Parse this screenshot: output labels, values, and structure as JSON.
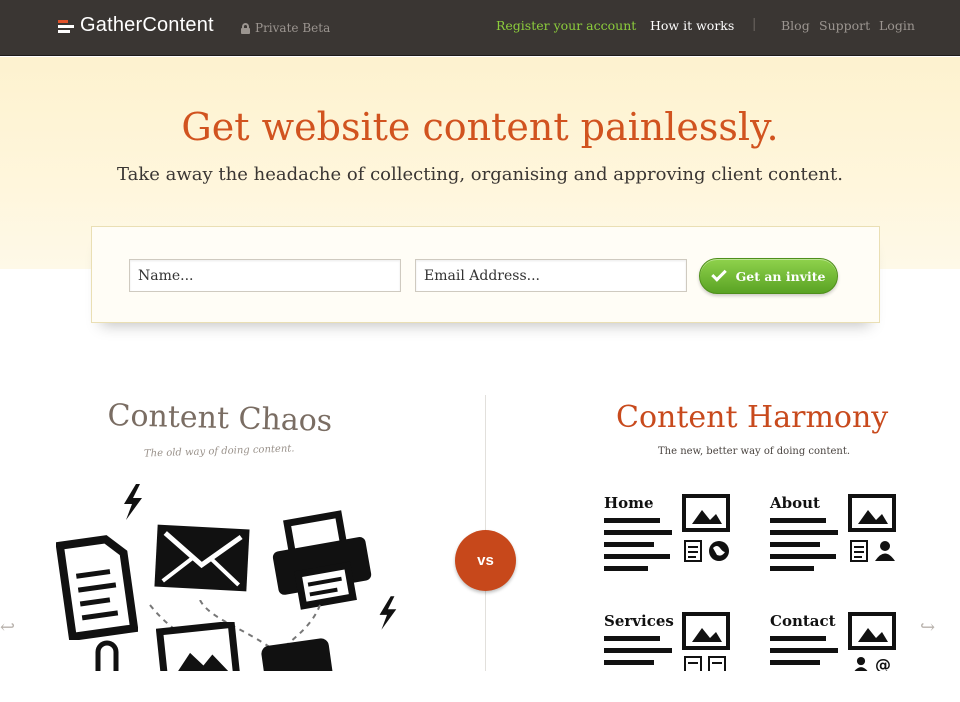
{
  "nav": {
    "brand": "GatherContent",
    "beta": "Private Beta",
    "register": "Register your account",
    "how_it_works": "How it works",
    "separator": "|",
    "blog": "Blog",
    "support": "Support",
    "login": "Login"
  },
  "hero": {
    "title": "Get website content painlessly.",
    "subtitle": "Take away the headache of collecting, organising and approving client content."
  },
  "invite": {
    "name_placeholder": "Name...",
    "email_placeholder": "Email Address...",
    "button_label": "Get an invite",
    "button_color": "#6ab72f"
  },
  "compare": {
    "chaos_title": "Content Chaos",
    "chaos_subtitle": "The old way of doing content.",
    "vs_label": "vs",
    "harmony_title": "Content Harmony",
    "harmony_subtitle": "The new, better way of doing content.",
    "cards": [
      {
        "label": "Home",
        "icons": [
          "document-icon",
          "globe-icon"
        ]
      },
      {
        "label": "About",
        "icons": [
          "document-icon",
          "person-icon"
        ]
      },
      {
        "label": "Services",
        "icons": [
          "document-icon",
          "document-icon"
        ]
      },
      {
        "label": "Contact",
        "icons": [
          "person-icon",
          "at-icon"
        ]
      }
    ]
  },
  "colors": {
    "accent": "#d1531f",
    "topbar": "#3a3633",
    "nav_highlight": "#8ccd3c"
  }
}
